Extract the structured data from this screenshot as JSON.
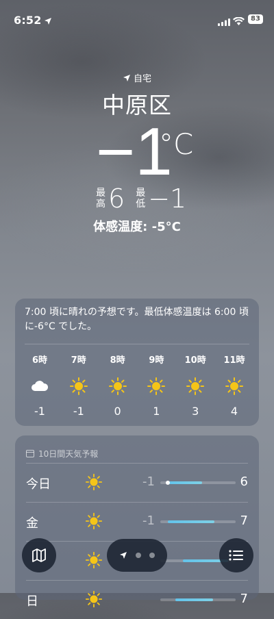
{
  "status_bar": {
    "time": "6:52",
    "battery": "83"
  },
  "location": {
    "label": "自宅",
    "city": "中原区"
  },
  "current": {
    "temp": "−1",
    "unit": "°C",
    "high_label": [
      "最",
      "高"
    ],
    "high": "6",
    "low_label": [
      "最",
      "低"
    ],
    "low": "−1",
    "feels_like": "体感温度: -5°C"
  },
  "hourly": {
    "summary": "7:00 頃に晴れの予想です。最低体感温度は 6:00 頃に-6°C でした。",
    "items": [
      {
        "time": "6時",
        "icon": "cloud-icon",
        "temp": "-1"
      },
      {
        "time": "7時",
        "icon": "sun-icon",
        "temp": "-1"
      },
      {
        "time": "8時",
        "icon": "sun-icon",
        "temp": "0"
      },
      {
        "time": "9時",
        "icon": "sun-icon",
        "temp": "1"
      },
      {
        "time": "10時",
        "icon": "sun-icon",
        "temp": "3"
      },
      {
        "time": "11時",
        "icon": "sun-icon",
        "temp": "4"
      }
    ]
  },
  "daily": {
    "title": "10日間天気予報",
    "days": [
      {
        "day": "今日",
        "icon": "sun-icon",
        "low": "-1",
        "high": "6",
        "bar_start": 0.1,
        "bar_end": 0.55,
        "current_marker": 0.1
      },
      {
        "day": "金",
        "icon": "sun-icon",
        "low": "-1",
        "high": "7",
        "bar_start": 0.1,
        "bar_end": 0.72
      },
      {
        "day": "",
        "icon": "sun-icon",
        "low": "",
        "high": "",
        "bar_start": 0.3,
        "bar_end": 0.9
      },
      {
        "day": "日",
        "icon": "sun-icon",
        "low": "",
        "high": "7",
        "bar_start": 0.2,
        "bar_end": 0.7
      }
    ]
  },
  "colors": {
    "sun": "#f5c518",
    "temp_bar": "#63c3ea"
  }
}
